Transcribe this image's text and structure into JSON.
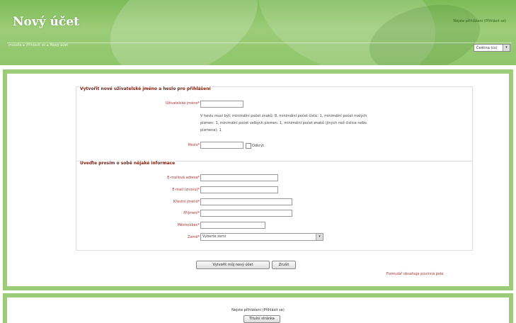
{
  "header": {
    "title": "Nový účet",
    "login_info": "Nejste přihlášeni (Přihlásit se)"
  },
  "breadcrumb": {
    "items": [
      "moodle",
      "Přihlásit se",
      "Nový účet"
    ]
  },
  "language": {
    "selected": "Čeština (cs)"
  },
  "form": {
    "section1": {
      "legend": "Vytvořit nové uživatelské jméno a heslo pro přihlášení",
      "username_label": "Uživatelské jméno",
      "password_rules": [
        "V heslu musí být: minimální počet znaků: 8, minimální počet číslic: 1, minimální počet malých",
        "písmen: 1, minimální počet velkých písmen: 1, minimální počet znaků (jiných než číslice nebo",
        "písmena): 1"
      ],
      "password_label": "Heslo",
      "unmask_label": "Odkrýt"
    },
    "section2": {
      "legend": "Uveďte prosím o sobě nějaké informace",
      "email_label": "E-mailová adresa",
      "email2_label": "E-mail (znovu)",
      "firstname_label": "Křestní jméno",
      "lastname_label": "Příjmení",
      "city_label": "Město/obec",
      "country_label": "Země",
      "country_placeholder": "Vyberte zemi"
    },
    "submit_label": "Vytvořit můj nový účet",
    "cancel_label": "Zrušit",
    "required_note": "Formulář obsahuje povinná pole",
    "required_mark": "*"
  },
  "footer": {
    "login_info": "Nejste přihlášeni (Přihlásit se)",
    "home_button": "Titulní stránka"
  }
}
